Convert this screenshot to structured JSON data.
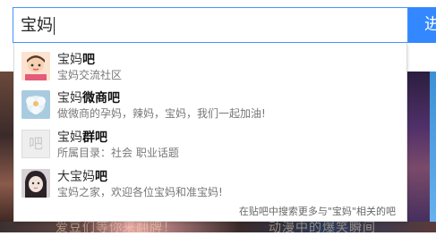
{
  "search": {
    "query": "宝妈",
    "button_label": "进"
  },
  "suggestions": [
    {
      "prefix": "宝妈",
      "bold": "吧",
      "desc": "宝妈交流社区",
      "icon": "baby-mom-avatar-icon"
    },
    {
      "prefix": "宝妈",
      "bold": "微商吧",
      "desc": "做微商的孕妈，辣妈，宝妈，我们一起加油!",
      "icon": "flower-avatar-icon"
    },
    {
      "prefix": "宝妈",
      "bold": "群吧",
      "desc": "所属目录：社会  职业话题",
      "icon": "default-forum-icon",
      "icon_glyph": "吧"
    },
    {
      "prefix": "大宝妈",
      "bold": "吧",
      "desc": "宝妈之家，欢迎各位宝妈和准宝妈!",
      "icon": "girl-avatar-icon"
    }
  ],
  "footer": "在贴吧中搜索更多与\"宝妈\"相关的吧",
  "background": {
    "caption_left": "爱豆们等你来翻牌！",
    "caption_right": "动漫中的爆笑瞬间"
  },
  "colors": {
    "accent": "#3388ff",
    "border": "#4791ff"
  }
}
